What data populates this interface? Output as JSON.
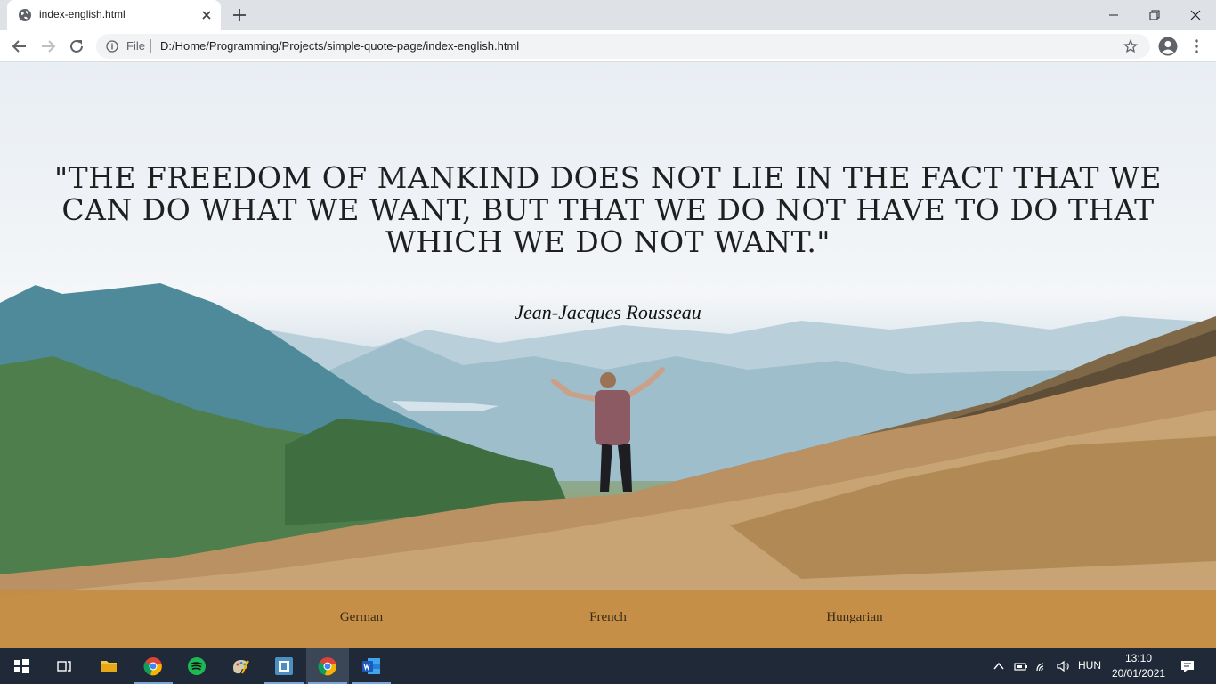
{
  "browser": {
    "tab": {
      "title": "index-english.html",
      "favicon": "globe-icon"
    },
    "address": {
      "scheme_label": "File",
      "url": "D:/Home/Programming/Projects/simple-quote-page/index-english.html"
    }
  },
  "page": {
    "quote": "\"The freedom of mankind does not lie in the fact that we can do what we want, but that we do not have to do that which we do not want.\"",
    "author": "Jean-Jacques Rousseau",
    "languages": [
      {
        "label": "German"
      },
      {
        "label": "French"
      },
      {
        "label": "Hungarian"
      }
    ]
  },
  "taskbar": {
    "apps": [
      "start-icon",
      "task-view-icon",
      "file-explorer-icon",
      "chrome-icon",
      "spotify-icon",
      "paint-icon",
      "terminal-icon",
      "chrome-icon",
      "word-icon"
    ],
    "language": "HUN",
    "time": "13:10",
    "date": "20/01/2021"
  },
  "colors": {
    "tabstrip": "#dee1e6",
    "language_bar": "#c48c42",
    "taskbar": "#1f2937"
  }
}
